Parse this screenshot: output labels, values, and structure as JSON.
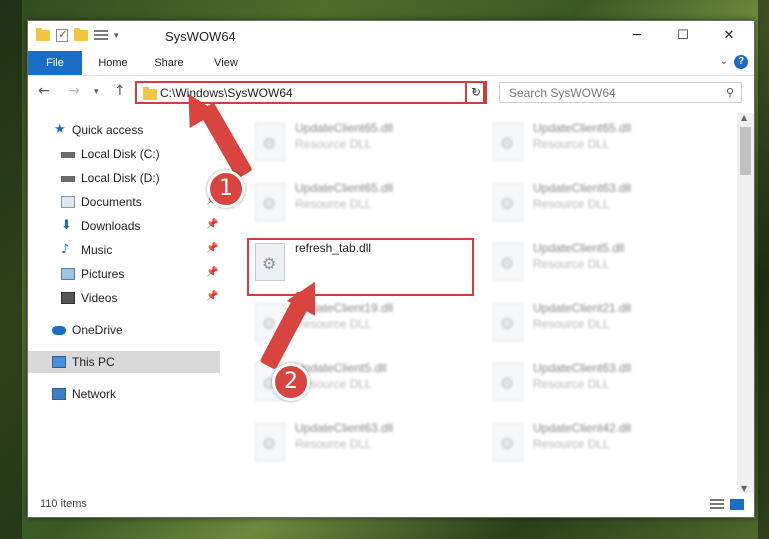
{
  "window": {
    "title": "SysWOW64"
  },
  "ribbon": {
    "tabs": [
      "File",
      "Home",
      "Share",
      "View"
    ]
  },
  "address": {
    "path": "C:\\Windows\\SysWOW64"
  },
  "search": {
    "placeholder": "Search SysWOW64"
  },
  "sidebar": {
    "items": [
      {
        "label": "Quick access",
        "icon": "star-icon"
      },
      {
        "label": "Local Disk (C:)",
        "icon": "drive-icon"
      },
      {
        "label": "Local Disk (D:)",
        "icon": "drive-icon"
      },
      {
        "label": "Documents",
        "icon": "documents-icon"
      },
      {
        "label": "Downloads",
        "icon": "download-icon"
      },
      {
        "label": "Music",
        "icon": "music-icon"
      },
      {
        "label": "Pictures",
        "icon": "pictures-icon"
      },
      {
        "label": "Videos",
        "icon": "videos-icon"
      },
      {
        "label": "OneDrive",
        "icon": "cloud-icon"
      },
      {
        "label": "This PC",
        "icon": "pc-icon"
      },
      {
        "label": "Network",
        "icon": "network-icon"
      }
    ]
  },
  "files": {
    "col1": [
      {
        "name": "UpdateClient65.dll",
        "type": "Resource DLL"
      },
      {
        "name": "UpdateClient65.dll",
        "type": "Resource DLL"
      },
      {
        "name": "refresh_tab.dll",
        "type": ""
      },
      {
        "name": "UpdateClient19.dll",
        "type": "Resource DLL"
      },
      {
        "name": "UpdateClient5.dll",
        "type": "Resource DLL"
      },
      {
        "name": "UpdateClient63.dll",
        "type": "Resource DLL"
      }
    ],
    "col2": [
      {
        "name": "UpdateClient65.dll",
        "type": "Resource DLL"
      },
      {
        "name": "UpdateClient63.dll",
        "type": "Resource DLL"
      },
      {
        "name": "UpdateClient5.dll",
        "type": "Resource DLL"
      },
      {
        "name": "UpdateClient21.dll",
        "type": "Resource DLL"
      },
      {
        "name": "UpdateClient63.dll",
        "type": "Resource DLL"
      },
      {
        "name": "UpdateClient42.dll",
        "type": "Resource DLL"
      }
    ]
  },
  "status": {
    "items_count": "110 items"
  },
  "annotations": {
    "badge1": "1",
    "badge2": "2"
  },
  "colors": {
    "accent": "#1a6dc7",
    "highlight": "#d43b3b"
  }
}
